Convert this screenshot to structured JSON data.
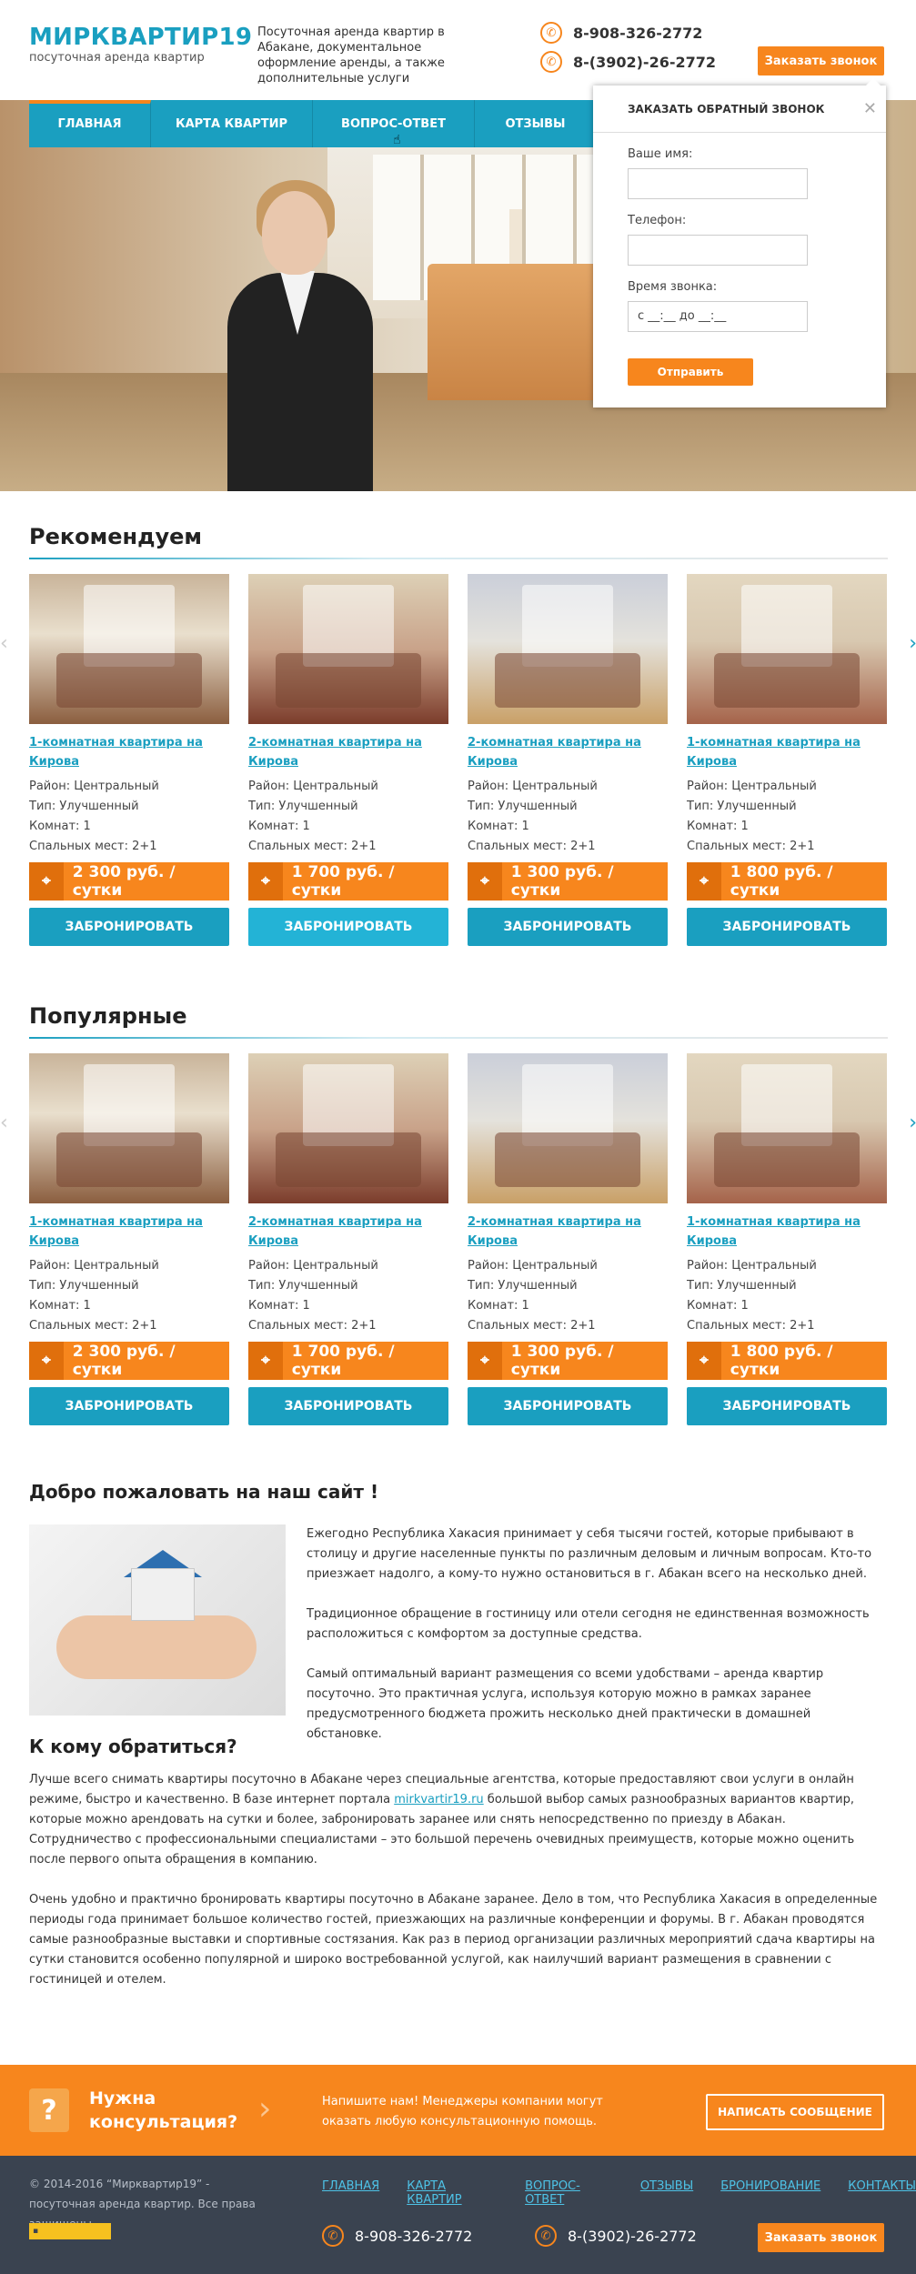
{
  "header": {
    "logo_title": "МИРКВАРТИР19",
    "logo_subtitle": "посуточная аренда квартир",
    "description": "Посуточная аренда квартир в Абакане, документальное оформление аренды, а также дополнительные услуги",
    "phone1": "8-908-326-2772",
    "phone2": "8-(3902)-26-2772",
    "call_button": "Заказать звонок",
    "phone_icon": "phone-icon"
  },
  "nav": {
    "items": [
      "Главная",
      "Карта квартир",
      "Вопрос-ответ",
      "Отзывы"
    ]
  },
  "popup": {
    "title": "ЗАКАЗАТЬ ОБРАТНЫЙ ЗВОНОК",
    "name_label": "Ваше имя:",
    "phone_label": "Телефон:",
    "time_label": "Время звонка:",
    "time_value": "с __:__ до __:__",
    "submit": "Отправить",
    "close_icon": "close-icon"
  },
  "recommended": {
    "title": "Рекомендуем",
    "cards": [
      {
        "title": "1-комнатная квартира на Кирова",
        "district": "Район: Центральный",
        "type": "Тип: Улучшенный",
        "rooms": "Комнат: 1",
        "beds": "Спальных мест: 2+1",
        "price": "2 300 руб. / сутки",
        "book": "ЗАБРОНИРОВАТЬ"
      },
      {
        "title": "2-комнатная квартира на Кирова",
        "district": "Район: Центральный",
        "type": "Тип: Улучшенный",
        "rooms": "Комнат: 1",
        "beds": "Спальных мест: 2+1",
        "price": "1 700 руб. / сутки",
        "book": "ЗАБРОНИРОВАТЬ"
      },
      {
        "title": "2-комнатная квартира на Кирова",
        "district": "Район: Центральный",
        "type": "Тип: Улучшенный",
        "rooms": "Комнат: 1",
        "beds": "Спальных мест: 2+1",
        "price": "1 300 руб. / сутки",
        "book": "ЗАБРОНИРОВАТЬ"
      },
      {
        "title": "1-комнатная квартира на Кирова",
        "district": "Район: Центральный",
        "type": "Тип: Улучшенный",
        "rooms": "Комнат: 1",
        "beds": "Спальных мест: 2+1",
        "price": "1 800 руб. / сутки",
        "book": "ЗАБРОНИРОВАТЬ"
      }
    ]
  },
  "popular": {
    "title": "Популярные",
    "cards": [
      {
        "title": "1-комнатная квартира на Кирова",
        "district": "Район: Центральный",
        "type": "Тип: Улучшенный",
        "rooms": "Комнат: 1",
        "beds": "Спальных мест: 2+1",
        "price": "2 300 руб. / сутки",
        "book": "ЗАБРОНИРОВАТЬ"
      },
      {
        "title": "2-комнатная квартира на Кирова",
        "district": "Район: Центральный",
        "type": "Тип: Улучшенный",
        "rooms": "Комнат: 1",
        "beds": "Спальных мест: 2+1",
        "price": "1 700 руб. / сутки",
        "book": "ЗАБРОНИРОВАТЬ"
      },
      {
        "title": "2-комнатная квартира на Кирова",
        "district": "Район: Центральный",
        "type": "Тип: Улучшенный",
        "rooms": "Комнат: 1",
        "beds": "Спальных мест: 2+1",
        "price": "1 300 руб. / сутки",
        "book": "ЗАБРОНИРОВАТЬ"
      },
      {
        "title": "1-комнатная квартира на Кирова",
        "district": "Район: Центральный",
        "type": "Тип: Улучшенный",
        "rooms": "Комнат: 1",
        "beds": "Спальных мест: 2+1",
        "price": "1 800 руб. / сутки",
        "book": "ЗАБРОНИРОВАТЬ"
      }
    ]
  },
  "welcome": {
    "title": "Добро пожаловать на наш сайт !",
    "p1": "Ежегодно Республика Хакасия принимает у себя тысячи гостей, которые прибывают в столицу и другие населенные пункты по различным деловым и личным вопросам. Кто-то приезжает надолго, а кому-то нужно остановиться в г. Абакан всего на несколько дней.",
    "p2": "Традиционное обращение в гостиницу или отели сегодня не единственная возможность расположиться с комфортом за доступные средства.",
    "p3": "Самый оптимальный вариант размещения со всеми удобствами – аренда квартир посуточно. Это практичная услуга, используя которую можно в рамках заранее предусмотренного бюджета прожить несколько дней практически в домашней обстановке."
  },
  "whom": {
    "title": "К кому обратиться?",
    "p1_a": "Лучше всего снимать квартиры посуточно в Абакане через специальные агентства, которые предоставляют свои услуги в онлайн режиме, быстро и качественно. В базе интернет портала ",
    "p1_link": "mirkvartir19.ru",
    "p1_b": " большой выбор самых разнообразных вариантов квартир, которые можно арендовать на сутки и более, забронировать заранее или снять непосредственно по приезду в Абакан. Сотрудничество с профессиональными специалистами – это большой перечень очевидных преимуществ, которые можно оценить после первого опыта обращения в компанию.",
    "p2": "Очень удобно и практично бронировать квартиры посуточно в Абакане заранее. Дело в том, что Республика Хакасия в определенные периоды года принимает большое количество гостей, приезжающих на различные конференции и форумы. В г. Абакан проводятся самые разнообразные выставки и спортивные состязания. Как раз в период организации различных мероприятий сдача квартиры на сутки становится особенно популярной и широко востребованной услугой, как наилучший вариант размещения в сравнении с гостиницей и отелем."
  },
  "consult": {
    "title_l1": "Нужна",
    "title_l2": "консультация?",
    "desc_l1": "Напишите нам! Менеджеры компании могут",
    "desc_l2": "оказать любую консультационную помощь.",
    "button": "НАПИСАТЬ СООБЩЕНИЕ"
  },
  "footer": {
    "copyright": "© 2014-2016 “Мирквартир19” - посуточная аренда квартир. Все права защищены.",
    "links": [
      "ГЛАВНАЯ",
      "КАРТА КВАРТИР",
      "ВОПРОС-ОТВЕТ",
      "ОТЗЫВЫ",
      "БРОНИРОВАНИЕ",
      "КОНТАКТЫ"
    ],
    "phone1": "8-908-326-2772",
    "phone2": "8-(3902)-26-2772",
    "call_button": "Заказать звонок"
  },
  "colors": {
    "accent": "#1a9fc0",
    "orange": "#f7861d",
    "footer": "#3a4350"
  }
}
